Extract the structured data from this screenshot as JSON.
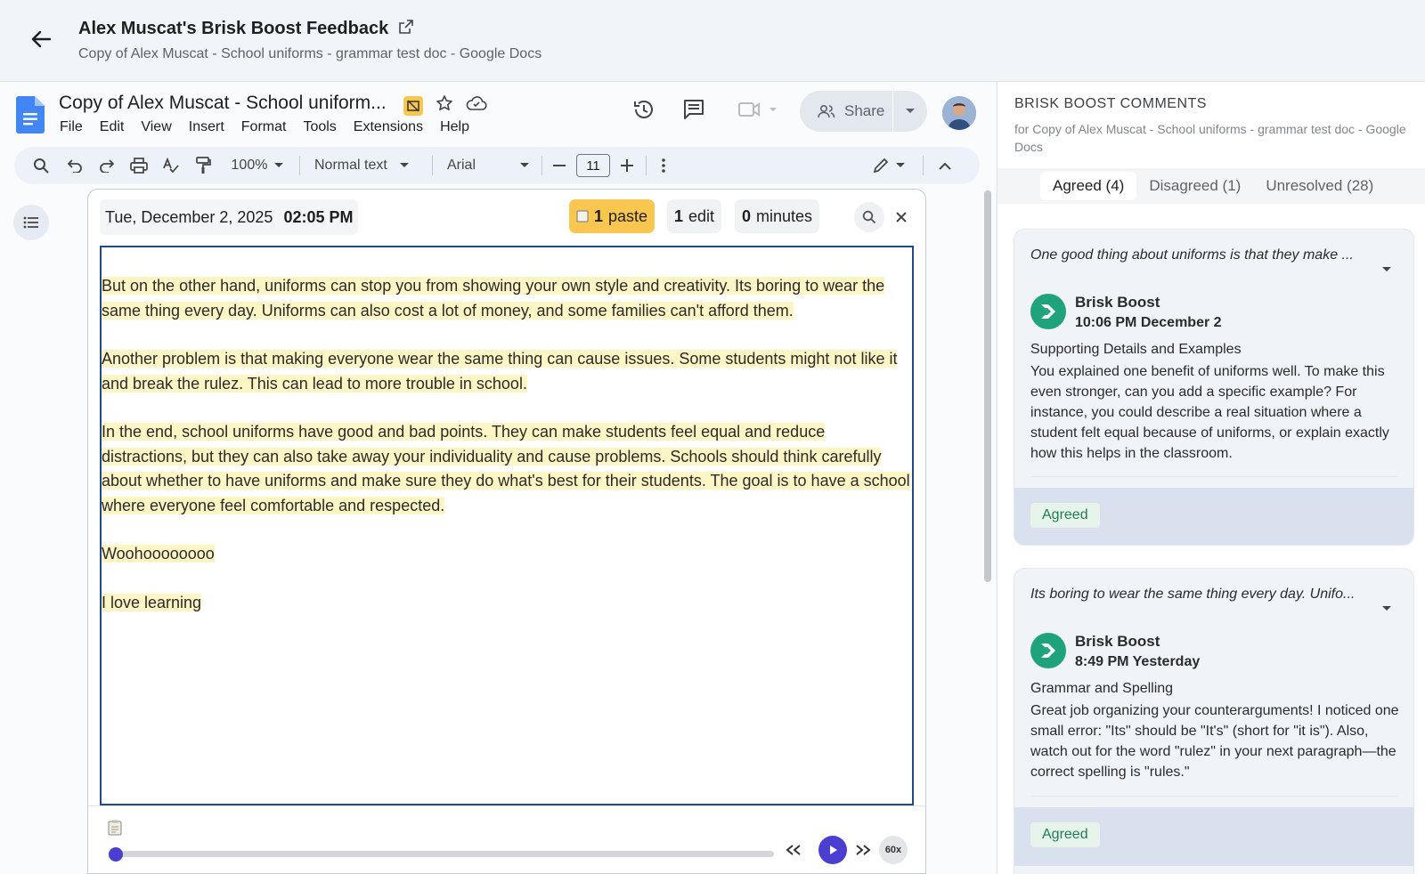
{
  "header": {
    "title": "Alex Muscat's Brisk Boost Feedback",
    "subtitle": "Copy of Alex Muscat - School uniforms - grammar test doc - Google Docs"
  },
  "docs": {
    "title": "Copy of Alex Muscat - School uniform...",
    "menu": [
      "File",
      "Edit",
      "View",
      "Insert",
      "Format",
      "Tools",
      "Extensions",
      "Help"
    ],
    "share_label": "Share",
    "toolbar": {
      "zoom": "100%",
      "style": "Normal text",
      "font": "Arial",
      "font_size": "11"
    }
  },
  "replay": {
    "date": "Tue, December 2, 2025",
    "time": "02:05 PM",
    "paste_count": "1",
    "paste_label": "paste",
    "edit_count": "1",
    "edit_label": "edit",
    "minutes_count": "0",
    "minutes_label": "minutes",
    "paragraphs": [
      "But on the other hand, uniforms can stop you from showing your own style and creativity. Its boring to wear the same thing every day. Uniforms can also cost a lot of money, and some families can't afford them.",
      "Another problem is that making everyone wear the same thing can cause issues. Some students might not like it and break the rulez. This can lead to more trouble in school.",
      "In the end, school uniforms have good and bad points. They can make students feel equal and reduce distractions, but they can also take away your individuality and cause problems. Schools should think carefully about whether to have uniforms and make sure they do what's best for their students. The goal is to have a school where everyone feel comfortable and respected.",
      "Woohoooooooo",
      "I love learning"
    ],
    "speed": "60x",
    "progress_fraction": 0.0
  },
  "panel": {
    "heading": "BRISK BOOST COMMENTS",
    "subheading": "for Copy of Alex Muscat - School uniforms - grammar test doc - Google Docs",
    "tabs": [
      "Agreed (4)",
      "Disagreed (1)",
      "Unresolved (28)"
    ],
    "active_tab": 0,
    "comments": [
      {
        "quote": "One good thing about uniforms is that they make ...",
        "author": "Brisk Boost",
        "time": "10:06 PM December 2",
        "category": "Supporting Details and Examples",
        "body": "You explained one benefit of uniforms well. To make this even stronger, can you add a specific example? For instance, you could describe a real situation where a student felt equal because of uniforms, or explain exactly how this helps in the classroom.",
        "status": "Agreed"
      },
      {
        "quote": "Its boring to wear the same thing every day. Unifo...",
        "author": "Brisk Boost",
        "time": "8:49 PM Yesterday",
        "category": "Grammar and Spelling",
        "body": "Great job organizing your counterarguments! I noticed one small error: \"Its\" should be \"It's\" (short for \"it is\"). Also, watch out for the word \"rulez\" in your next paragraph—the correct spelling is \"rules.\"",
        "status": "Agreed"
      }
    ]
  },
  "colors": {
    "accent": "#4a3fd1",
    "highlight": "#fdf5c4",
    "paste_badge": "#f9c74f",
    "brisk_green": "#1fa37a"
  }
}
